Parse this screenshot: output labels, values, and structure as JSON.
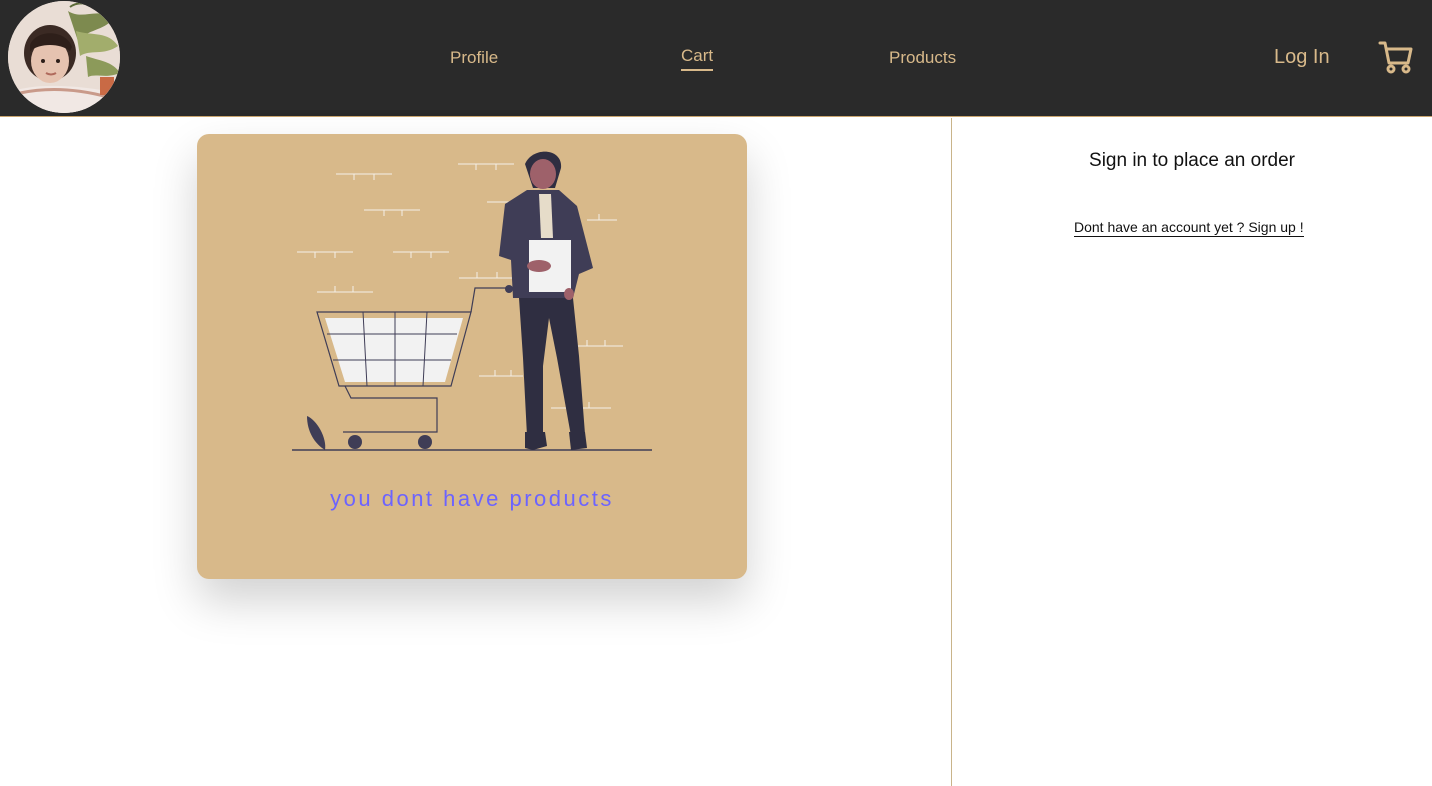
{
  "nav": {
    "profile": "Profile",
    "cart": "Cart",
    "products": "Products",
    "login": "Log In",
    "cart_icon": "shopping-cart-icon",
    "avatar": "user-avatar"
  },
  "empty_cart": {
    "message": "you dont have products",
    "illustration": "shopping-cart-illustration"
  },
  "signin_panel": {
    "title": "Sign in to place an order",
    "signup_link": "Dont have an account yet ? Sign up !"
  },
  "colors": {
    "header_bg": "#2a2a2a",
    "accent": "#d8b98a",
    "message": "#6c63ff",
    "figure": "#3f3d56"
  }
}
